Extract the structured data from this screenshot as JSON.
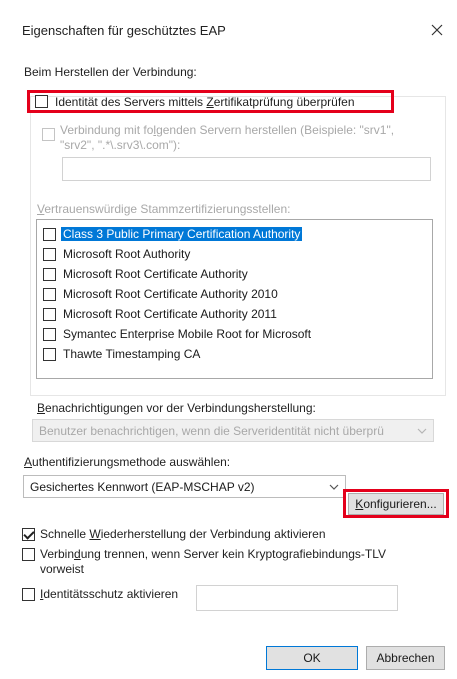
{
  "window": {
    "title": "Eigenschaften für geschütztes EAP"
  },
  "connection": {
    "heading": "Beim Herstellen der Verbindung:",
    "verify_identity": {
      "pre": "Identität des Servers mittels ",
      "ul": "Z",
      "post": "ertifikatprüfung überprüfen",
      "checked": false
    },
    "connect_servers": {
      "line1_pre": "Verbindung mit fo",
      "line1_ul": "l",
      "line1_post": "genden Servern herstellen (Beispiele: \"srv1\",",
      "line2": "\"srv2\", \".*\\.srv3\\.com\"):",
      "checked": false
    },
    "servers_input_value": ""
  },
  "trusted_ca": {
    "label_ul": "V",
    "label_rest": "ertrauenswürdige Stammzertifizierungsstellen:",
    "items": [
      {
        "label": "Class 3 Public Primary Certification Authority",
        "checked": false,
        "selected": true
      },
      {
        "label": "Microsoft Root Authority",
        "checked": false,
        "selected": false
      },
      {
        "label": "Microsoft Root Certificate Authority",
        "checked": false,
        "selected": false
      },
      {
        "label": "Microsoft Root Certificate Authority 2010",
        "checked": false,
        "selected": false
      },
      {
        "label": "Microsoft Root Certificate Authority 2011",
        "checked": false,
        "selected": false
      },
      {
        "label": "Symantec Enterprise Mobile Root for Microsoft",
        "checked": false,
        "selected": false
      },
      {
        "label": "Thawte Timestamping CA",
        "checked": false,
        "selected": false
      }
    ]
  },
  "notifications": {
    "label_ul": "B",
    "label_rest": "enachrichtigungen vor der Verbindungsherstellung:",
    "value": "Benutzer benachrichtigen, wenn die Serveridentität nicht überprü"
  },
  "auth": {
    "label_ul": "A",
    "label_rest": "uthentifizierungsmethode auswählen:",
    "method_value": "Gesichertes Kennwort (EAP-MSCHAP v2)",
    "configure_ul": "K",
    "configure_rest": "onfigurieren..."
  },
  "options": {
    "fast_reconnect": {
      "pre": "Schnelle ",
      "ul": "W",
      "post": "iederherstellung der Verbindung aktivieren",
      "checked": true
    },
    "disconnect_tlv": {
      "line1_pre": "Verbin",
      "line1_ul": "d",
      "line1_post": "ung trennen, wenn Server kein Kryptografiebindungs-TLV",
      "line2": "vorweist",
      "checked": false
    },
    "identity_privacy": {
      "ul": "I",
      "post": "dentitätsschutz aktivieren",
      "checked": false,
      "value": ""
    }
  },
  "buttons": {
    "ok": "OK",
    "cancel": "Abbrechen"
  },
  "colors": {
    "highlight": "#e4001b",
    "selection": "#0078d7",
    "disabled_text": "#a8a8a8"
  }
}
